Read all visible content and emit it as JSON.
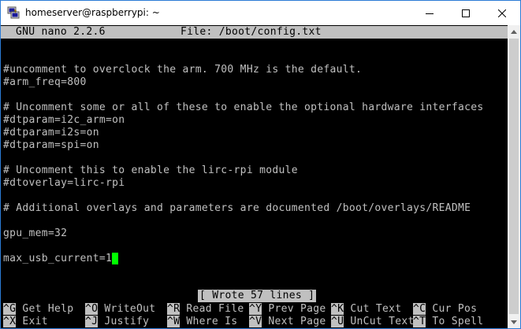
{
  "window": {
    "title": "homeserver@raspberrypi: ~",
    "app_icon": "putty-terminal-icon",
    "accent": "#2b7bd6"
  },
  "nano": {
    "version": "GNU nano 2.2.6",
    "file": "File: /boot/config.txt",
    "lines": [
      "",
      "",
      "#uncomment to overclock the arm. 700 MHz is the default.",
      "#arm_freq=800",
      "",
      "# Uncomment some or all of these to enable the optional hardware interfaces",
      "#dtparam=i2c_arm=on",
      "#dtparam=i2s=on",
      "#dtparam=spi=on",
      "",
      "# Uncomment this to enable the lirc-rpi module",
      "#dtoverlay=lirc-rpi",
      "",
      "# Additional overlays and parameters are documented /boot/overlays/README",
      "",
      "gpu_mem=32",
      "",
      "max_usb_current=1"
    ],
    "status": "[ Wrote 57 lines ]",
    "cursor_color": "#00ff00",
    "shortcuts_row1": [
      {
        "key": "^G",
        "label": " Get Help  "
      },
      {
        "key": "^O",
        "label": " WriteOut  "
      },
      {
        "key": "^R",
        "label": " Read File "
      },
      {
        "key": "^Y",
        "label": " Prev Page "
      },
      {
        "key": "^K",
        "label": " Cut Text  "
      },
      {
        "key": "^C",
        "label": " Cur Pos"
      }
    ],
    "shortcuts_row2": [
      {
        "key": "^X",
        "label": " Exit      "
      },
      {
        "key": "^J",
        "label": " Justify   "
      },
      {
        "key": "^W",
        "label": " Where Is  "
      },
      {
        "key": "^V",
        "label": " Next Page "
      },
      {
        "key": "^U",
        "label": " UnCut Text"
      },
      {
        "key": "^T",
        "label": " To Spell"
      }
    ]
  }
}
